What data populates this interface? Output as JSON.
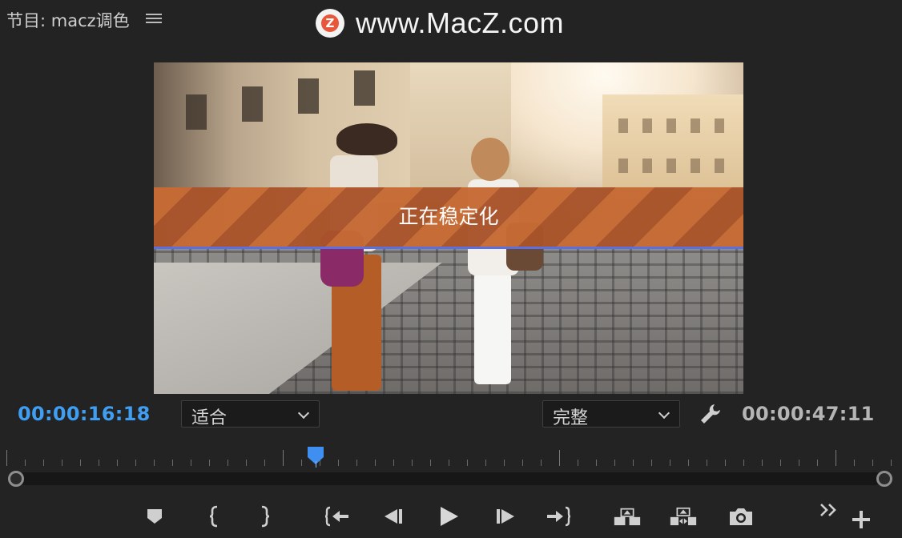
{
  "panel": {
    "title": "节目: macz调色"
  },
  "watermark": {
    "logo_letter": "Z",
    "text": "www.MacZ.com"
  },
  "viewer": {
    "overlay_text": "正在稳定化",
    "stabilize_progress": 1.0
  },
  "timecode": {
    "current": "00:00:16:18",
    "duration": "00:00:47:11",
    "current_color": "#3f9ef2"
  },
  "zoom_dropdown": {
    "selected": "适合"
  },
  "quality_dropdown": {
    "selected": "完整"
  },
  "timeline": {
    "playhead_fraction": 0.35
  },
  "icons": {
    "panel_menu": "hamburger-icon",
    "settings": "wrench-icon",
    "marker": "marker-icon",
    "mark_in": "mark-in-icon",
    "mark_out": "mark-out-icon",
    "go_to_in": "go-to-in-icon",
    "step_back": "step-back-icon",
    "play": "play-icon",
    "step_forward": "step-forward-icon",
    "go_to_out": "go-to-out-icon",
    "lift": "lift-icon",
    "extract": "extract-icon",
    "export_frame": "camera-icon",
    "more": "double-chevron-icon",
    "add": "plus-icon"
  },
  "colors": {
    "background": "#232323",
    "accent_blue": "#3f9ef2",
    "banner_orange": "#c66a34"
  }
}
